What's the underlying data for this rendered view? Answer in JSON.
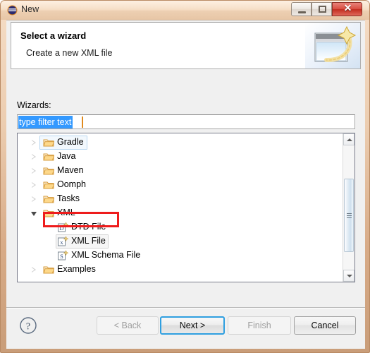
{
  "window": {
    "title": "New",
    "icon": "eclipse-circle-icon",
    "controls": {
      "minimize": "minimize-button",
      "maximize": "maximize-button",
      "close_glyph": "✕"
    }
  },
  "header": {
    "title": "Select a wizard",
    "description": "Create a new XML file",
    "banner_icon": "wizard-banner-icon"
  },
  "form": {
    "wizards_label": "Wizards:",
    "filter": {
      "value": "type filter text",
      "placeholder": "type filter text",
      "selected": true
    }
  },
  "tree": {
    "items": [
      {
        "label": "Gradle",
        "icon": "folder-icon",
        "level": 0,
        "state": "collapsed",
        "highlight": "focus"
      },
      {
        "label": "Java",
        "icon": "folder-icon",
        "level": 0,
        "state": "collapsed",
        "highlight": "none"
      },
      {
        "label": "Maven",
        "icon": "folder-icon",
        "level": 0,
        "state": "collapsed",
        "highlight": "none"
      },
      {
        "label": "Oomph",
        "icon": "folder-icon",
        "level": 0,
        "state": "collapsed",
        "highlight": "none"
      },
      {
        "label": "Tasks",
        "icon": "folder-icon",
        "level": 0,
        "state": "collapsed",
        "highlight": "none"
      },
      {
        "label": "XML",
        "icon": "folder-icon",
        "level": 0,
        "state": "expanded",
        "highlight": "none"
      },
      {
        "label": "DTD File",
        "icon": "dtd-file-icon",
        "level": 1,
        "state": "leaf",
        "highlight": "annotated",
        "badge": "D"
      },
      {
        "label": "XML File",
        "icon": "xml-file-icon",
        "level": 1,
        "state": "leaf",
        "highlight": "hover",
        "badge": "x"
      },
      {
        "label": "XML Schema File",
        "icon": "xml-schema-file-icon",
        "level": 1,
        "state": "leaf",
        "highlight": "none",
        "badge": "S"
      },
      {
        "label": "Examples",
        "icon": "folder-icon",
        "level": 0,
        "state": "collapsed",
        "highlight": "none"
      }
    ],
    "annotation_color": "#ee1c1c",
    "scrollbar": {
      "orientation": "vertical",
      "thumb_position": "middle"
    }
  },
  "buttons": {
    "help": "?",
    "back": {
      "label": "< Back",
      "enabled": false
    },
    "next": {
      "label": "Next >",
      "enabled": true,
      "default": true
    },
    "finish": {
      "label": "Finish",
      "enabled": false
    },
    "cancel": {
      "label": "Cancel",
      "enabled": true
    }
  },
  "colors": {
    "frame": "#eccdb0",
    "selection": "#3399ff",
    "annotation": "#ee1c1c",
    "default_button_focus": "#2f9fe0"
  }
}
